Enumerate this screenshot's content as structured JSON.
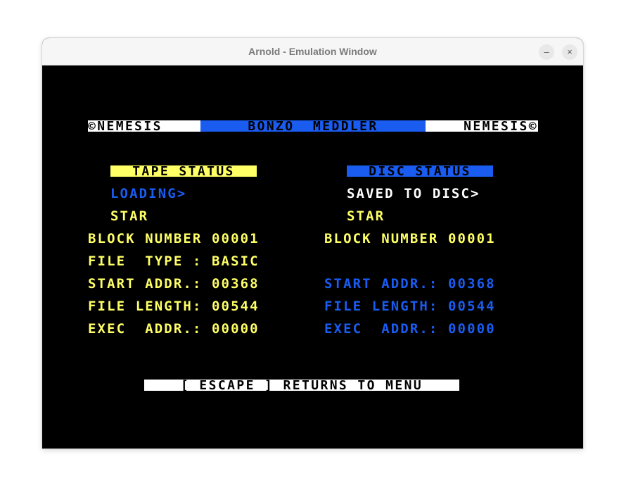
{
  "window": {
    "title": "Arnold - Emulation Window",
    "minimize_glyph": "–",
    "close_glyph": "×"
  },
  "screen": {
    "header": {
      "left": "©NEMESIS",
      "center": "BONZO  MEDDLER",
      "right": "NEMESIS©"
    },
    "tape": {
      "title": "TAPE STATUS",
      "state": "LOADING>",
      "name": "STAR",
      "block": "BLOCK NUMBER 00001",
      "filetype": "FILE  TYPE : BASIC",
      "start": "START ADDR.: 00368",
      "length": "FILE LENGTH: 00544",
      "exec": "EXEC  ADDR.: 00000"
    },
    "disc": {
      "title": "DISC STATUS",
      "state": "SAVED TO DISC>",
      "name": "STAR",
      "block": "BLOCK NUMBER 00001",
      "start": "START ADDR.: 00368",
      "length": "FILE LENGTH: 00544",
      "exec": "EXEC  ADDR.: 00000"
    },
    "footer": "[ ESCAPE ] RETURNS TO MENU"
  },
  "colors": {
    "yellow": "#ffff66",
    "blue": "#1a5cf0",
    "white": "#ffffff",
    "background": "#000000"
  }
}
